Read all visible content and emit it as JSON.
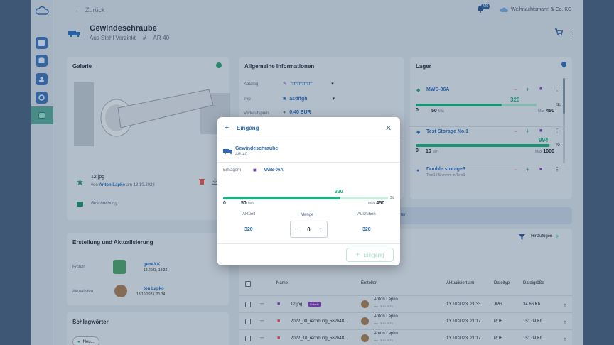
{
  "topbar": {
    "back_label": "Zurück",
    "notif_count": "420",
    "company": "Weihnachtsmann & Co. KG"
  },
  "product": {
    "name": "Gewindeschraube",
    "material": "Aus Stahl Verzinkt",
    "sku": "AR-40"
  },
  "gallery": {
    "title": "Galerie",
    "filename": "12.jpg",
    "by_prefix": "von",
    "by_user": "Anton Lapko",
    "by_date": "am 13.10.2023",
    "description_label": "Beschreibung"
  },
  "general": {
    "title": "Allgemeine Informationen",
    "katalog_label": "Katalog",
    "katalog_value": "rrrrrrrrrrrrr",
    "typ_label": "Typ",
    "typ_value": "asdffgh",
    "price_label": "Verkaufspreis",
    "price_value": "0,40 EUR"
  },
  "lager": {
    "title": "Lager",
    "items": [
      {
        "name": "MWS-06A",
        "current": "320",
        "min": "50",
        "max": "450",
        "min_label": "Min",
        "max_label": "Max",
        "unit": "St.",
        "fill": 0.71
      },
      {
        "name": "Test Storage No.1",
        "current": "994",
        "min": "10",
        "max": "1000",
        "min_label": "Min",
        "max_label": "Max",
        "unit": "St.",
        "fill": 0.99
      },
      {
        "name": "Double storage3",
        "sub": "Tenr1 / Shmmm in Tenr1"
      }
    ]
  },
  "history": {
    "title": "Erstellung und Aktualisierung",
    "created_label": "Erstellt",
    "created_user": "gene3 K",
    "created_date": "18.2023, 13:32",
    "updated_label": "Aktualisiert",
    "updated_user": "ton Lapko",
    "updated_date": "13.10.2023, 21:34"
  },
  "tags": {
    "title": "Schlagwörter",
    "new_label": "Neu..."
  },
  "files": {
    "tab_label": "ten",
    "add_label": "Hinzufügen",
    "columns": {
      "name": "Name",
      "creator": "Ersteller",
      "updated": "Aktualisiert am",
      "type": "Dateityp",
      "size": "Dateigröße"
    },
    "rows": [
      {
        "name": "12.jpg",
        "tag": "Galerie",
        "creator": "Anton Lapko",
        "creator_date": "am 13.10.2023",
        "updated": "13.10.2023, 21:33",
        "type": "JPG",
        "size": "34.66 Kb"
      },
      {
        "name": "2022_08_rechnung_562648...",
        "creator": "Anton Lapko",
        "creator_date": "am 13.10.2023",
        "updated": "13.10.2023, 21:17",
        "type": "PDF",
        "size": "151.09 Kb"
      },
      {
        "name": "2022_10_rechnung_562648...",
        "creator": "Anton Lapko",
        "creator_date": "am 13.10.2023",
        "updated": "13.10.2023, 21:17",
        "type": "PDF",
        "size": "151.09 Kb"
      }
    ]
  },
  "modal": {
    "title": "Eingang",
    "product_name": "Gewindeschraube",
    "product_sku": "AR-40",
    "einlagern_label": "Einlagern",
    "storage": "MWS-06A",
    "current": "320",
    "min": "50",
    "min_label": "Min",
    "max": "450",
    "max_label": "Max",
    "zero": "0",
    "unit": "St.",
    "fill": 0.71,
    "col_actual": "Aktuell",
    "col_amount": "Menge",
    "col_reserved": "Ausruhen",
    "actual_value": "320",
    "amount_value": "0",
    "reserved_value": "320",
    "submit_label": "Eingang"
  },
  "colors": {
    "accent": "#2b6cb5",
    "green": "#1fa77b",
    "red": "#d9534f",
    "purple": "#7b3fb5"
  }
}
